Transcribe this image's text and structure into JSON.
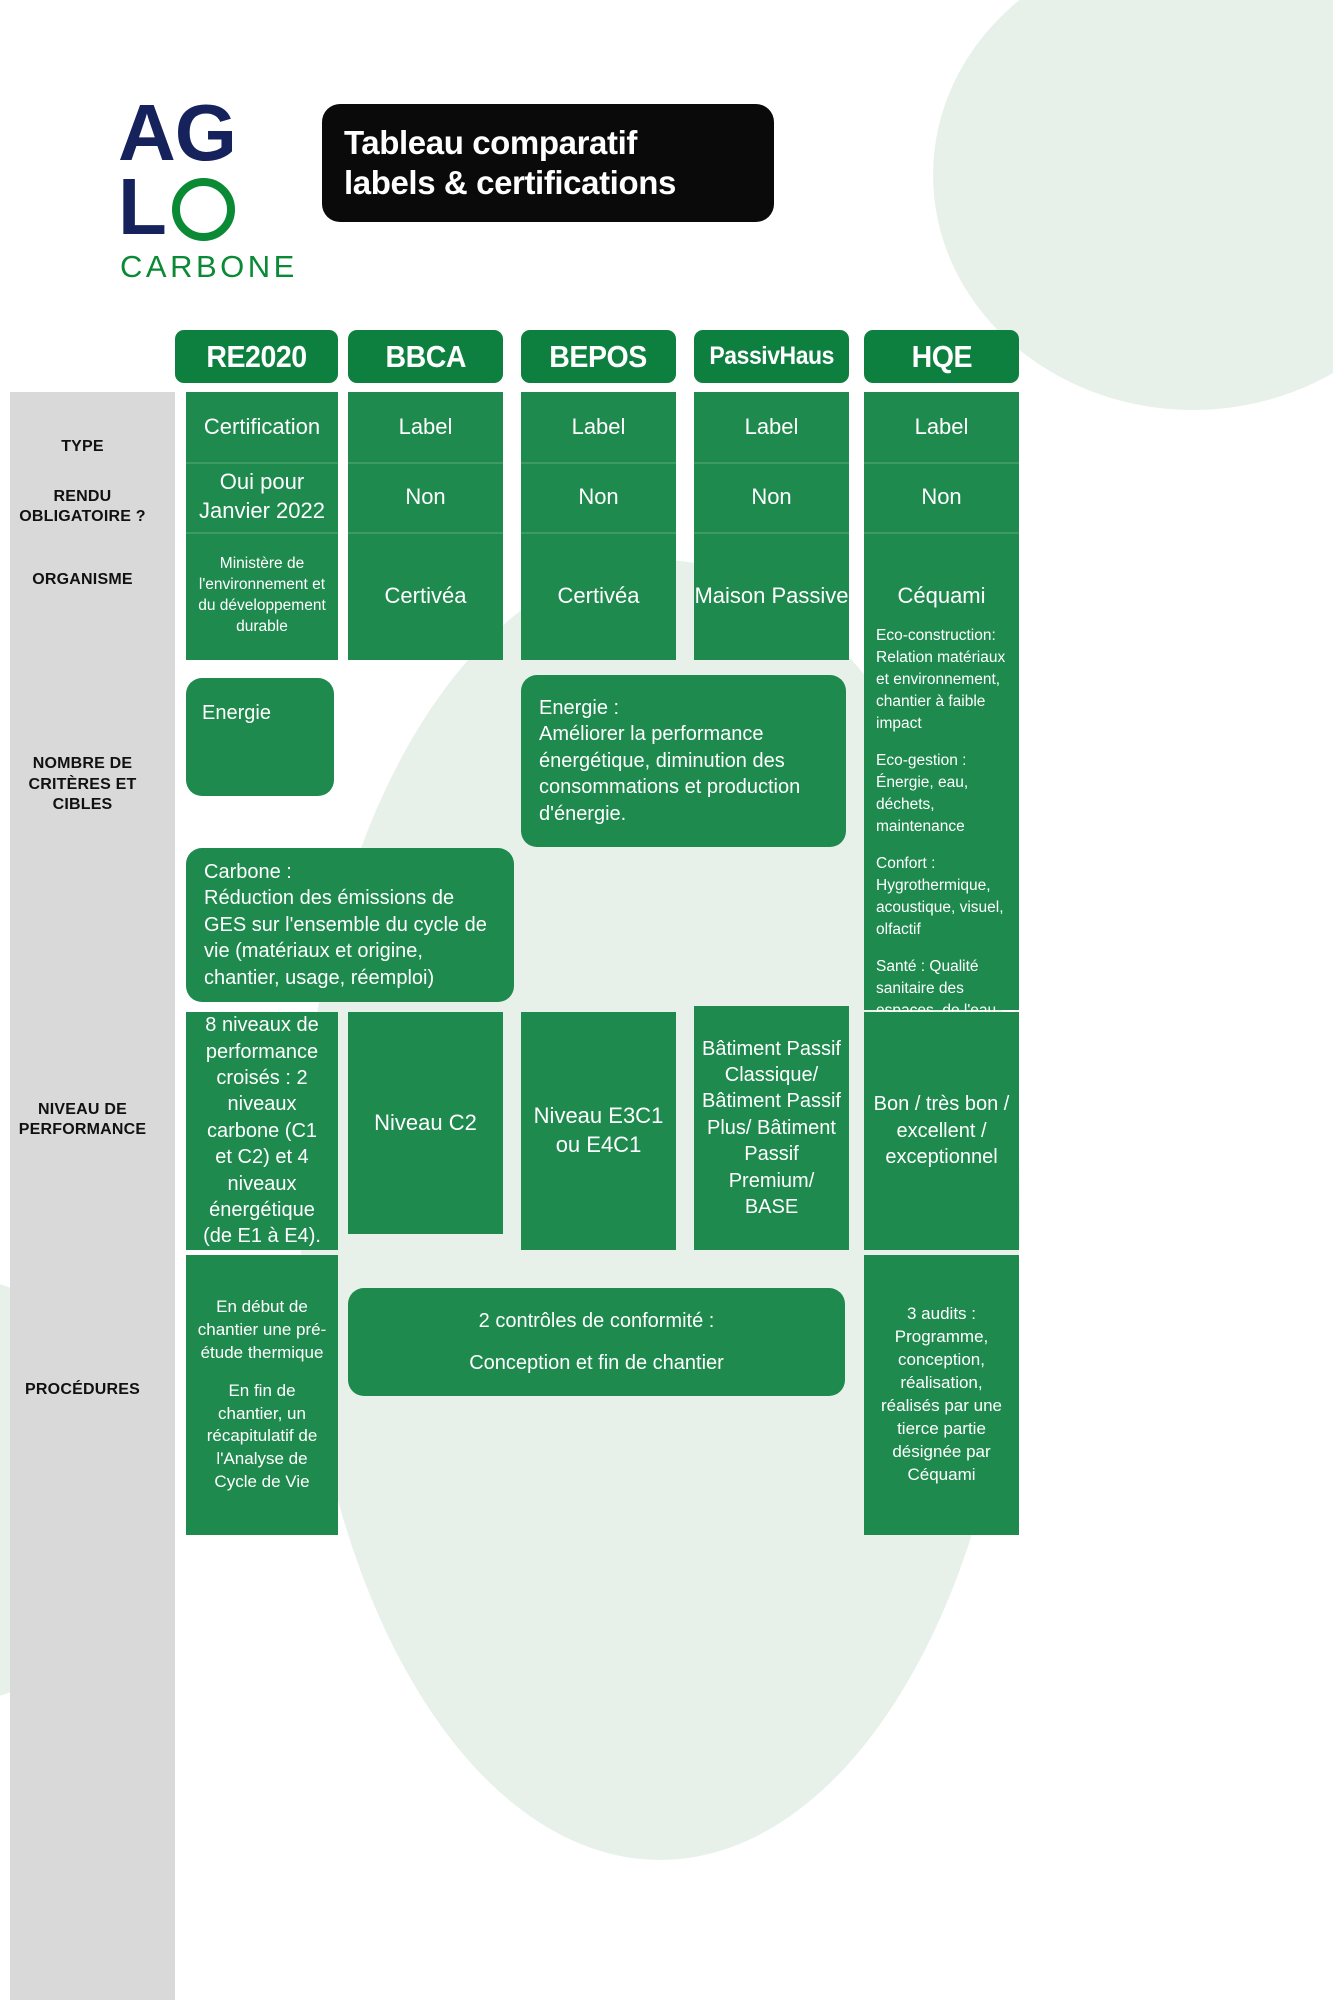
{
  "brand": {
    "logo_line1": "AG",
    "logo_line2": "L",
    "logo_word": "CARBONE",
    "navy": "#15225c",
    "green": "#0a8a35"
  },
  "header": {
    "title_line1": "Tableau comparatif",
    "title_line2": "labels & certifications",
    "title_bg": "#0a0a0a"
  },
  "table": {
    "accent": "#0d8040",
    "cell_green": "#1e8a4e",
    "label_bg": "#d9d9d9",
    "columns": [
      {
        "label": "RE2020"
      },
      {
        "label": "BBCA"
      },
      {
        "label": "BEPOS"
      },
      {
        "label": "PassivHaus"
      },
      {
        "label": "HQE"
      }
    ],
    "row_labels": [
      "TYPE",
      "RENDU OBLIGATOIRE ?",
      "ORGANISME",
      "NOMBRE DE CRITÈRES ET CIBLES",
      "NIVEAU DE PERFORMANCE",
      "PROCÉDURES"
    ],
    "type": {
      "re2020": "Certification",
      "bbca": "Label",
      "bepos": "Label",
      "passivhaus": "Label",
      "hqe": "Label"
    },
    "rendu": {
      "re2020": "Oui pour Janvier 2022",
      "bbca": "Non",
      "bepos": "Non",
      "passivhaus": "Non",
      "hqe": "Non"
    },
    "organisme": {
      "re2020": "Ministère de l'environnement et du développement durable",
      "bbca": "Certivéa",
      "bepos": "Certivéa",
      "passivhaus": "Maison Passive",
      "hqe": "Céquami"
    },
    "criteres": {
      "re2020_energie": "Energie",
      "re2020_carbone_title": "Carbone :",
      "re2020_carbone_body": "Réduction des émissions de GES sur l'ensemble du cycle de vie (matériaux et origine, chantier, usage, réemploi)",
      "bepos_energie_title": "Energie :",
      "bepos_energie_body": "Améliorer la performance énergétique, diminution des consommations et production d'énergie.",
      "hqe_1": "Eco-construction: Relation matériaux et environnement, chantier à faible impact",
      "hqe_2": "Eco-gestion : Énergie, eau, déchets, maintenance",
      "hqe_3": "Confort : Hygrothermique, acoustique, visuel, olfactif",
      "hqe_4": "Santé : Qualité sanitaire des espaces, de l'eau et de l'air"
    },
    "performance": {
      "re2020": "8 niveaux de performance croisés : 2 niveaux carbone (C1 et C2) et 4 niveaux énergétique (de E1 à E4).",
      "bbca": "Niveau C2",
      "bepos": "Niveau E3C1 ou E4C1",
      "passivhaus": "Bâtiment Passif Classique/ Bâtiment Passif Plus/ Bâtiment Passif Premium/ BASE",
      "hqe": "Bon / très bon / excellent / exceptionnel"
    },
    "procedures": {
      "re2020_a": "En début de chantier une pré-étude thermique",
      "re2020_b": "En fin de chantier, un récapitulatif de l'Analyse de Cycle de Vie",
      "shared_a": "2 contrôles de conformité :",
      "shared_b": "Conception et fin de chantier",
      "hqe": "3 audits : Programme, conception, réalisation, réalisés par une tierce partie désignée par Céquami"
    }
  }
}
